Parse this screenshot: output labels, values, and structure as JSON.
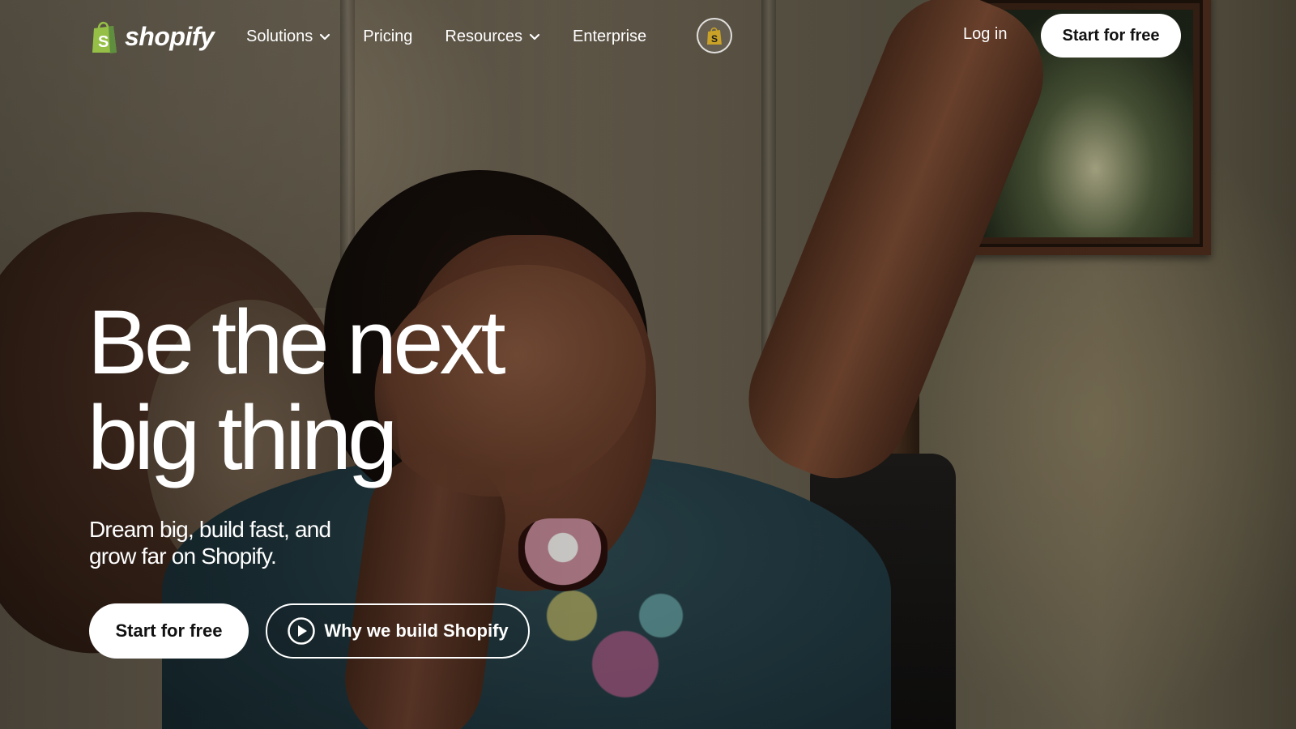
{
  "brand": {
    "name": "shopify",
    "accent_color": "#95bf47",
    "logo_icon": "shopify-bag-icon"
  },
  "nav": {
    "items": [
      {
        "label": "Solutions",
        "has_dropdown": true
      },
      {
        "label": "Pricing",
        "has_dropdown": false
      },
      {
        "label": "Resources",
        "has_dropdown": true
      },
      {
        "label": "Enterprise",
        "has_dropdown": false
      }
    ],
    "shop_badge_icon": "shop-app-icon"
  },
  "header": {
    "login_label": "Log in",
    "cta_label": "Start for free"
  },
  "hero": {
    "headline_line1": "Be the next",
    "headline_line2": "big thing",
    "subhead_line1": "Dream big, build fast, and",
    "subhead_line2": "grow far on Shopify.",
    "primary_cta": "Start for free",
    "secondary_cta": "Why we build Shopify",
    "secondary_icon": "play-circle-icon"
  },
  "colors": {
    "text_on_hero": "#ffffff",
    "button_bg": "#ffffff",
    "button_text": "#111111"
  }
}
